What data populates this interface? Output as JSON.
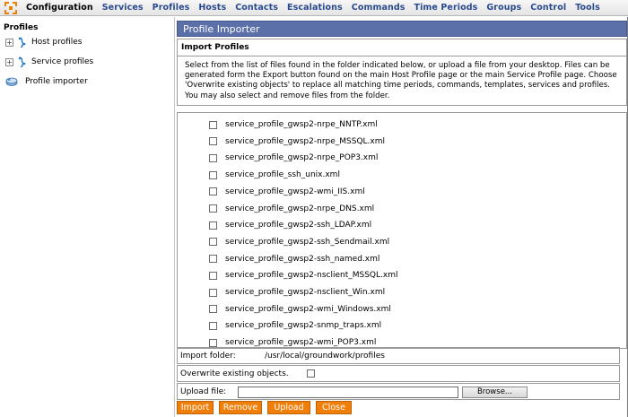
{
  "menu": {
    "items": [
      "Configuration",
      "Services",
      "Profiles",
      "Hosts",
      "Contacts",
      "Escalations",
      "Commands",
      "Time Periods",
      "Groups",
      "Control",
      "Tools"
    ],
    "active": "Configuration",
    "accent": "#2a4a8e"
  },
  "sidebar": {
    "title": "Profiles",
    "items": [
      {
        "label": "Host profiles",
        "icon": "tree-icon"
      },
      {
        "label": "Service profiles",
        "icon": "tree-icon"
      },
      {
        "label": "Profile importer",
        "icon": "import-icon"
      }
    ]
  },
  "panel": {
    "header": "Profile Importer",
    "header_color": "#5b6fa8",
    "section_title": "Import Profiles",
    "instructions": "Select from the list of files found in the folder indicated below, or upload a file from your desktop. Files can be generated form the Export button found on the main Host Profile page or the main Service Profile page. Choose 'Overwrite existing objects' to replace all matching time periods, commands, templates, services and profiles. You may also select and remove files from the folder."
  },
  "files": [
    "service_profile_gwsp2-nrpe_NNTP.xml",
    "service_profile_gwsp2-nrpe_MSSQL.xml",
    "service_profile_gwsp2-nrpe_POP3.xml",
    "service_profile_ssh_unix.xml",
    "service_profile_gwsp2-wmi_IIS.xml",
    "service_profile_gwsp2-nrpe_DNS.xml",
    "service_profile_gwsp2-ssh_LDAP.xml",
    "service_profile_gwsp2-ssh_Sendmail.xml",
    "service_profile_gwsp2-ssh_named.xml",
    "service_profile_gwsp2-nsclient_MSSQL.xml",
    "service_profile_gwsp2-nsclient_Win.xml",
    "service_profile_gwsp2-wmi_Windows.xml",
    "service_profile_gwsp2-snmp_traps.xml",
    "service_profile_gwsp2-wmi_POP3.xml"
  ],
  "import_folder": {
    "label": "Import folder:",
    "value": "/usr/local/groundwork/profiles"
  },
  "overwrite": {
    "label": "Overwrite existing objects.",
    "checked": false
  },
  "upload": {
    "label": "Upload file:",
    "value": "",
    "browse_label": "Browse..."
  },
  "buttons": {
    "import": "Import",
    "remove": "Remove",
    "upload": "Upload",
    "close": "Close",
    "color": "#f07f0a"
  }
}
